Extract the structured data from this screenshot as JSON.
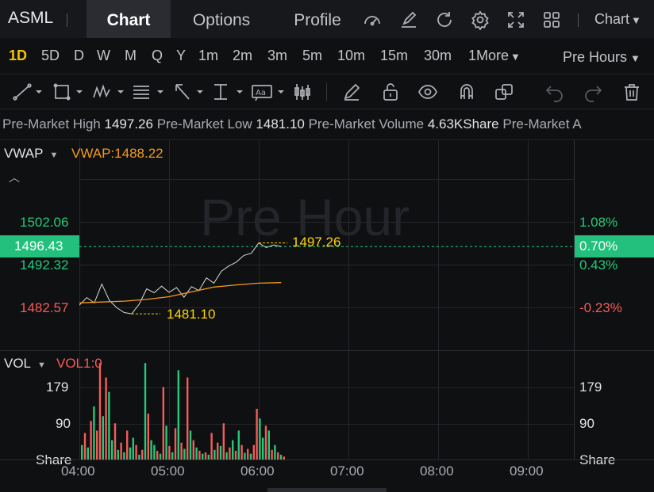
{
  "symbol": "ASML",
  "tabs": [
    {
      "label": "Chart",
      "active": true
    },
    {
      "label": "Options",
      "active": false
    },
    {
      "label": "Profile",
      "active": false
    }
  ],
  "toolbar_icons": [
    "speedometer-icon",
    "edit-icon",
    "refresh-icon",
    "settings-icon",
    "fullscreen-icon",
    "grid-icon"
  ],
  "chart_menu": "Chart",
  "timeframes": [
    "1D",
    "5D",
    "D",
    "W",
    "M",
    "Q",
    "Y",
    "1m",
    "2m",
    "3m",
    "5m",
    "10m",
    "15m",
    "30m",
    "1More"
  ],
  "active_timeframe": "1D",
  "session_menu": "Pre Hours",
  "info_line": [
    {
      "label": "Pre-Market High",
      "value": "1497.26"
    },
    {
      "label": "Pre-Market Low",
      "value": "1481.10"
    },
    {
      "label": "Pre-Market Volume",
      "value": "4.63KShare"
    },
    {
      "label": "Pre-Market A",
      "value": ""
    }
  ],
  "indicator": {
    "name": "VWAP",
    "value_label": "VWAP:1488.22"
  },
  "watermark": "Pre Hour",
  "price_axis": {
    "left": [
      {
        "text": "1502.06",
        "color": "green"
      },
      {
        "text": "1496.43",
        "color": "tag"
      },
      {
        "text": "1492.32",
        "color": "green"
      },
      {
        "text": "1482.57",
        "color": "red"
      }
    ],
    "right": [
      {
        "text": "1.08%",
        "color": "green"
      },
      {
        "text": "0.70%",
        "color": "tag"
      },
      {
        "text": "0.43%",
        "color": "green"
      },
      {
        "text": "-0.23%",
        "color": "red"
      }
    ]
  },
  "high_label": "1497.26",
  "low_label": "1481.10",
  "volume": {
    "name": "VOL",
    "value_label": "VOL1:0",
    "axis_left": [
      "179",
      "90",
      "Share"
    ],
    "axis_right": [
      "179",
      "90",
      "Share"
    ]
  },
  "time_axis": [
    "04:00",
    "05:00",
    "06:00",
    "07:00",
    "08:00",
    "09:00"
  ],
  "colors": {
    "up": "#25c87a",
    "down": "#f45c58",
    "accent": "#f5c400",
    "vwap": "#f39a1e",
    "price_line": "#d8d8d8"
  },
  "chart_data": {
    "type": "line",
    "x_label_ticks": [
      "04:00",
      "05:00",
      "06:00",
      "07:00",
      "08:00",
      "09:00"
    ],
    "ylim": [
      1477,
      1505
    ],
    "series": [
      {
        "name": "VWAP",
        "x": [
          "04:00",
          "04:15",
          "04:30",
          "04:45",
          "05:00",
          "05:15",
          "05:30",
          "05:45",
          "06:00",
          "06:15"
        ],
        "values": [
          1483.6,
          1483.8,
          1484.0,
          1484.4,
          1485.0,
          1486.1,
          1487.2,
          1487.7,
          1488.1,
          1488.22
        ]
      }
    ],
    "price": {
      "x": [
        "04:00",
        "04:05",
        "04:10",
        "04:15",
        "04:20",
        "04:25",
        "04:30",
        "04:35",
        "04:40",
        "04:45",
        "04:50",
        "04:55",
        "05:00",
        "05:05",
        "05:10",
        "05:15",
        "05:20",
        "05:25",
        "05:30",
        "05:35",
        "05:40",
        "05:45",
        "05:50",
        "05:55",
        "06:00",
        "06:05",
        "06:10",
        "06:15"
      ],
      "values": [
        1483.1,
        1484.8,
        1483.6,
        1487.9,
        1484.2,
        1482.5,
        1481.4,
        1481.1,
        1483.3,
        1486.8,
        1485.9,
        1487.4,
        1486.0,
        1487.1,
        1484.9,
        1487.3,
        1486.4,
        1489.3,
        1488.1,
        1490.8,
        1492.0,
        1492.9,
        1494.4,
        1494.9,
        1497.26,
        1496.2,
        1496.8,
        1496.43
      ]
    },
    "volume": {
      "ylim": [
        0,
        220
      ],
      "bars": [
        {
          "v": 30,
          "up": true
        },
        {
          "v": 55,
          "up": false
        },
        {
          "v": 25,
          "up": true
        },
        {
          "v": 80,
          "up": false
        },
        {
          "v": 110,
          "up": true
        },
        {
          "v": 60,
          "up": false
        },
        {
          "v": 200,
          "up": false
        },
        {
          "v": 90,
          "up": true
        },
        {
          "v": 170,
          "up": false
        },
        {
          "v": 140,
          "up": true
        },
        {
          "v": 40,
          "up": true
        },
        {
          "v": 75,
          "up": false
        },
        {
          "v": 20,
          "up": true
        },
        {
          "v": 35,
          "up": false
        },
        {
          "v": 15,
          "up": true
        },
        {
          "v": 60,
          "up": false
        },
        {
          "v": 25,
          "up": true
        },
        {
          "v": 45,
          "up": true
        },
        {
          "v": 30,
          "up": false
        },
        {
          "v": 10,
          "up": true
        },
        {
          "v": 20,
          "up": false
        },
        {
          "v": 200,
          "up": true
        },
        {
          "v": 95,
          "up": false
        },
        {
          "v": 40,
          "up": true
        },
        {
          "v": 30,
          "up": true
        },
        {
          "v": 18,
          "up": false
        },
        {
          "v": 12,
          "up": true
        },
        {
          "v": 150,
          "up": false
        },
        {
          "v": 70,
          "up": true
        },
        {
          "v": 28,
          "up": false
        },
        {
          "v": 15,
          "up": true
        },
        {
          "v": 65,
          "up": false
        },
        {
          "v": 185,
          "up": true
        },
        {
          "v": 35,
          "up": false
        },
        {
          "v": 22,
          "up": true
        },
        {
          "v": 170,
          "up": false
        },
        {
          "v": 60,
          "up": true
        },
        {
          "v": 40,
          "up": false
        },
        {
          "v": 25,
          "up": true
        },
        {
          "v": 18,
          "up": false
        },
        {
          "v": 12,
          "up": true
        },
        {
          "v": 15,
          "up": false
        },
        {
          "v": 10,
          "up": true
        },
        {
          "v": 55,
          "up": false
        },
        {
          "v": 20,
          "up": true
        },
        {
          "v": 35,
          "up": false
        },
        {
          "v": 28,
          "up": true
        },
        {
          "v": 75,
          "up": false
        },
        {
          "v": 15,
          "up": true
        },
        {
          "v": 25,
          "up": false
        },
        {
          "v": 40,
          "up": true
        },
        {
          "v": 18,
          "up": false
        },
        {
          "v": 60,
          "up": true
        },
        {
          "v": 30,
          "up": false
        },
        {
          "v": 14,
          "up": true
        },
        {
          "v": 22,
          "up": false
        },
        {
          "v": 12,
          "up": true
        },
        {
          "v": 30,
          "up": false
        },
        {
          "v": 105,
          "up": false
        },
        {
          "v": 85,
          "up": true
        },
        {
          "v": 45,
          "up": true
        },
        {
          "v": 70,
          "up": false
        },
        {
          "v": 60,
          "up": true
        },
        {
          "v": 20,
          "up": false
        },
        {
          "v": 30,
          "up": true
        },
        {
          "v": 15,
          "up": false
        },
        {
          "v": 10,
          "up": true
        },
        {
          "v": 6,
          "up": false
        }
      ]
    }
  }
}
